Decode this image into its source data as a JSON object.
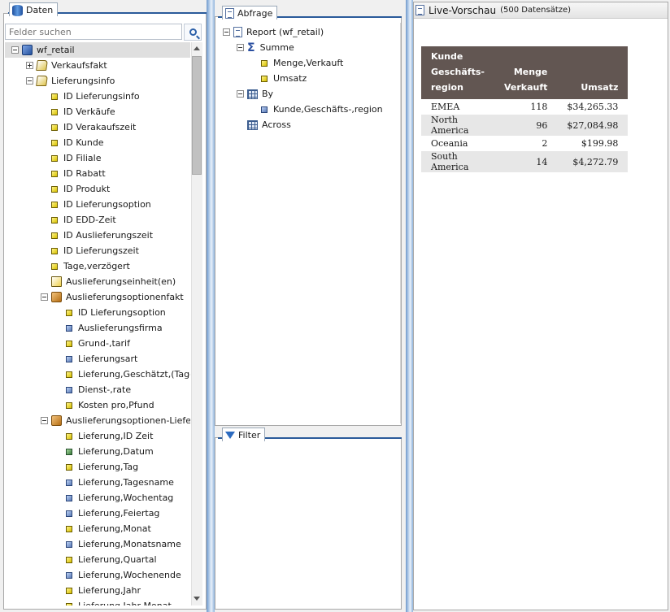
{
  "daten": {
    "tab_label": "Daten",
    "search_placeholder": "Felder suchen",
    "tree": [
      {
        "label": "wf_retail",
        "icon": "database-cube",
        "indent": 0,
        "expander": "minus",
        "selected": true
      },
      {
        "label": "Verkaufsfakt",
        "icon": "folder-link",
        "indent": 1,
        "expander": "plus"
      },
      {
        "label": "Lieferungsinfo",
        "icon": "folder-link",
        "indent": 1,
        "expander": "minus"
      },
      {
        "label": "ID Lieferungsinfo",
        "icon": "yellow",
        "indent": 2
      },
      {
        "label": "ID Verkäufe",
        "icon": "yellow",
        "indent": 2
      },
      {
        "label": "ID Verakaufszeit",
        "icon": "yellow",
        "indent": 2
      },
      {
        "label": "ID Kunde",
        "icon": "yellow",
        "indent": 2
      },
      {
        "label": "ID Filiale",
        "icon": "yellow",
        "indent": 2
      },
      {
        "label": "ID Rabatt",
        "icon": "yellow",
        "indent": 2
      },
      {
        "label": "ID Produkt",
        "icon": "yellow",
        "indent": 2
      },
      {
        "label": "ID Lieferungsoption",
        "icon": "yellow",
        "indent": 2
      },
      {
        "label": "ID EDD-Zeit",
        "icon": "yellow",
        "indent": 2
      },
      {
        "label": "ID Auslieferungszeit",
        "icon": "yellow",
        "indent": 2
      },
      {
        "label": "ID Lieferungszeit",
        "icon": "yellow",
        "indent": 2
      },
      {
        "label": "Tage,verzögert",
        "icon": "yellow",
        "indent": 2
      },
      {
        "label": "Auslieferungseinheit(en)",
        "icon": "measure",
        "indent": 2
      },
      {
        "label": "Auslieferungsoptionenfakt",
        "icon": "cube",
        "indent": 2,
        "expander": "minus"
      },
      {
        "label": "ID Lieferungsoption",
        "icon": "yellow",
        "indent": 3
      },
      {
        "label": "Auslieferungsfirma",
        "icon": "blue",
        "indent": 3
      },
      {
        "label": "Grund-,tarif",
        "icon": "yellow",
        "indent": 3
      },
      {
        "label": "Lieferungsart",
        "icon": "blue",
        "indent": 3
      },
      {
        "label": "Lieferung,Geschätzt,(Tage",
        "icon": "yellow",
        "indent": 3
      },
      {
        "label": "Dienst-,rate",
        "icon": "blue",
        "indent": 3
      },
      {
        "label": "Kosten pro,Pfund",
        "icon": "yellow",
        "indent": 3
      },
      {
        "label": "Auslieferungsoptionen-Lieferz",
        "icon": "cube",
        "indent": 2,
        "expander": "minus"
      },
      {
        "label": "Lieferung,ID Zeit",
        "icon": "yellow",
        "indent": 3
      },
      {
        "label": "Lieferung,Datum",
        "icon": "green",
        "indent": 3
      },
      {
        "label": "Lieferung,Tag",
        "icon": "yellow",
        "indent": 3
      },
      {
        "label": "Lieferung,Tagesname",
        "icon": "blue",
        "indent": 3
      },
      {
        "label": "Lieferung,Wochentag",
        "icon": "blue",
        "indent": 3
      },
      {
        "label": "Lieferung,Feiertag",
        "icon": "blue",
        "indent": 3
      },
      {
        "label": "Lieferung,Monat",
        "icon": "yellow",
        "indent": 3
      },
      {
        "label": "Lieferung,Monatsname",
        "icon": "blue",
        "indent": 3
      },
      {
        "label": "Lieferung,Quartal",
        "icon": "yellow",
        "indent": 3
      },
      {
        "label": "Lieferung,Wochenende",
        "icon": "blue",
        "indent": 3
      },
      {
        "label": "Lieferung,Jahr",
        "icon": "yellow",
        "indent": 3
      },
      {
        "label": "Lieferung,Jahr,Monat",
        "icon": "yellow",
        "indent": 3
      }
    ]
  },
  "abfrage": {
    "tab_label": "Abfrage",
    "tree": [
      {
        "label": "Report (wf_retail)",
        "icon": "report-page",
        "indent": 0,
        "expander": "minus"
      },
      {
        "label": "Summe",
        "icon": "sigma",
        "indent": 1,
        "expander": "minus"
      },
      {
        "label": "Menge,Verkauft",
        "icon": "yellow",
        "indent": 2
      },
      {
        "label": "Umsatz",
        "icon": "yellow",
        "indent": 2
      },
      {
        "label": "By",
        "icon": "grid",
        "indent": 1,
        "expander": "minus"
      },
      {
        "label": "Kunde,Geschäfts-,region",
        "icon": "blue",
        "indent": 2
      },
      {
        "label": "Across",
        "icon": "grid",
        "indent": 1
      }
    ]
  },
  "filter": {
    "tab_label": "Filter"
  },
  "live_preview": {
    "title": "Live-Vorschau",
    "record_count": "(500 Datensätze)",
    "header": {
      "region": [
        "Kunde",
        "Geschäfts-",
        "region"
      ],
      "qty": [
        "Menge",
        "Verkauft"
      ],
      "revenue": [
        "Umsatz"
      ]
    },
    "rows": [
      {
        "region": "EMEA",
        "qty": "118",
        "revenue": "$34,265.33"
      },
      {
        "region": "North America",
        "qty": "96",
        "revenue": "$27,084.98"
      },
      {
        "region": "Oceania",
        "qty": "2",
        "revenue": "$199.98"
      },
      {
        "region": "South America",
        "qty": "14",
        "revenue": "$4,272.79"
      }
    ]
  },
  "colors": {
    "table_header": "#625652",
    "tab_line": "#2a5a9a",
    "selection": "#dfdfdf"
  }
}
